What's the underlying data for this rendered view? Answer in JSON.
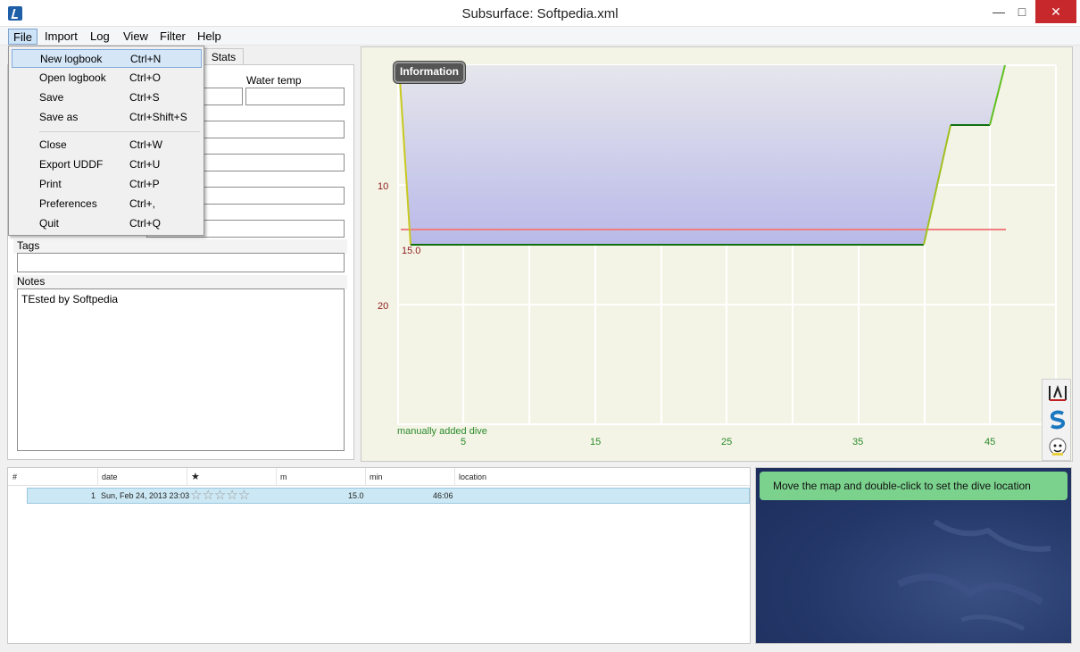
{
  "window": {
    "title": "Subsurface: Softpedia.xml",
    "minimize": "—",
    "maximize": "□",
    "close": "✕"
  },
  "menubar": {
    "file": "File",
    "import": "Import",
    "log": "Log",
    "view": "View",
    "filter": "Filter",
    "help": "Help"
  },
  "file_menu": [
    {
      "label": "New logbook",
      "shortcut": "Ctrl+N"
    },
    {
      "label": "Open logbook",
      "shortcut": "Ctrl+O"
    },
    {
      "label": "Save",
      "shortcut": "Ctrl+S"
    },
    {
      "label": "Save as",
      "shortcut": "Ctrl+Shift+S"
    },
    {
      "label": "Close",
      "shortcut": "Ctrl+W"
    },
    {
      "label": "Export UDDF",
      "shortcut": "Ctrl+U"
    },
    {
      "label": "Print",
      "shortcut": "Ctrl+P"
    },
    {
      "label": "Preferences",
      "shortcut": "Ctrl+,"
    },
    {
      "label": "Quit",
      "shortcut": "Ctrl+Q"
    }
  ],
  "details": {
    "stats_tab": "Stats",
    "water_temp_label": "Water temp",
    "tags_label": "Tags",
    "notes_label": "Notes",
    "notes_text": "TEsted by Softpedia"
  },
  "profile": {
    "info_button": "Information",
    "y_ticks": [
      "10",
      "20"
    ],
    "x_ticks": [
      "5",
      "15",
      "25",
      "35",
      "45"
    ],
    "max_depth_label": "15.0",
    "caption": "manually added dive",
    "colors": {
      "background": "#f4f4e6",
      "fill_top": "#e4e4ea",
      "fill_bottom": "#b8b8e8",
      "ceiling": "#f08080",
      "descent": "#c8c820",
      "bottom": "#107010",
      "ascent": "#60c020"
    }
  },
  "dive_list": {
    "headers": [
      "#",
      "date",
      "★",
      "m",
      "min",
      "location"
    ],
    "rows": [
      {
        "num": "1",
        "date": "Sun, Feb 24, 2013 23:03",
        "rating": "☆☆☆☆☆",
        "depth": "15.0",
        "duration": "46:06",
        "location": ""
      }
    ]
  },
  "map": {
    "banner": "Move the map and double-click to set the dive location"
  }
}
